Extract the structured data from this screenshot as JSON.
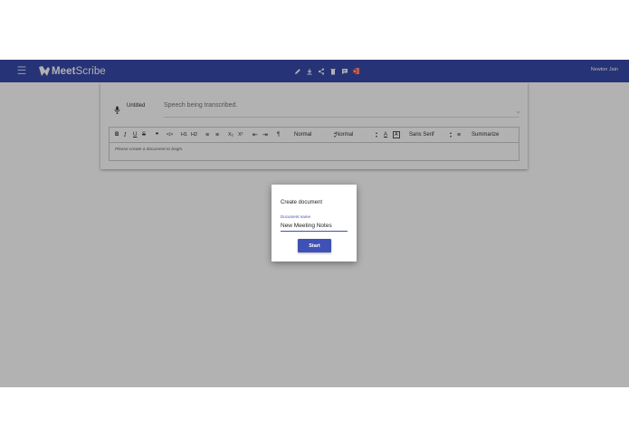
{
  "appbar": {
    "menu_icon": "hamburger-menu-icon",
    "logo_prefix": "Meet",
    "logo_suffix": "Scribe",
    "icons": [
      "pencil-icon",
      "download-icon",
      "share-icon",
      "trash-icon",
      "comment-icon",
      "onenote-icon"
    ],
    "user_name": "Newton Jain",
    "color": "#3949ab"
  },
  "speech": {
    "doc_title": "Untitled",
    "transcript_placeholder": "Speech being transcribed.",
    "clear_symbol": "×"
  },
  "format_bar": {
    "bold": "B",
    "italic": "I",
    "underline": "U",
    "strike": "S",
    "blockquote": "❞",
    "code": "</>",
    "h1": "H1",
    "h2": "H2",
    "ordered_list": "≡",
    "bullet_list": "≡",
    "subscript": "X₂",
    "superscript": "X²",
    "outdent": "⇤",
    "indent": "⇥",
    "direction": "¶",
    "size_select": "Normal",
    "header_select": "Normal",
    "font_color": "A",
    "background_color": "A",
    "font_select": "Sans Serif",
    "align": "≡",
    "summarize": "Summarize"
  },
  "editor": {
    "body_placeholder": "Please create a document to begin."
  },
  "dialog": {
    "title": "Create document",
    "field_label": "Document name",
    "field_value": "New Meeting Notes",
    "start_label": "Start",
    "accent": "#3f51b5"
  }
}
